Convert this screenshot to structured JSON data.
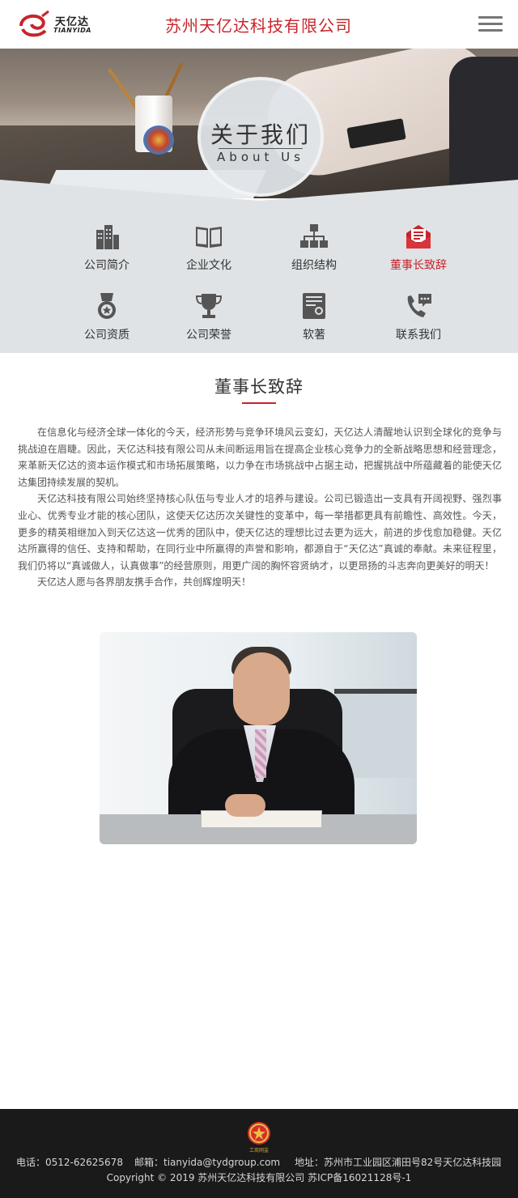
{
  "header": {
    "logo_cn": "天亿达",
    "logo_en": "TIANYIDA",
    "company_name": "苏州天亿达科技有限公司"
  },
  "banner": {
    "title_cn": "关于我们",
    "title_en": "About Us"
  },
  "nav": {
    "items": [
      {
        "label": "公司简介",
        "icon": "building-icon"
      },
      {
        "label": "企业文化",
        "icon": "book-icon"
      },
      {
        "label": "组织结构",
        "icon": "org-chart-icon"
      },
      {
        "label": "董事长致辞",
        "icon": "letter-icon",
        "active": true
      },
      {
        "label": "公司资质",
        "icon": "medal-icon"
      },
      {
        "label": "公司荣誉",
        "icon": "trophy-icon"
      },
      {
        "label": "软著",
        "icon": "certificate-icon"
      },
      {
        "label": "联系我们",
        "icon": "phone-chat-icon"
      }
    ]
  },
  "article": {
    "title": "董事长致辞",
    "paragraphs": [
      "在信息化与经济全球一体化的今天，经济形势与竞争环境风云变幻，天亿达人清醒地认识到全球化的竞争与挑战迫在眉睫。因此，天亿达科技有限公司从未间断运用旨在提高企业核心竞争力的全新战略思想和经营理念，来革新天亿达的资本运作模式和市场拓展策略，以力争在市场挑战中占据主动，把握挑战中所蕴藏着的能使天亿达集团持续发展的契机。",
      "天亿达科技有限公司始终坚持核心队伍与专业人才的培养与建设。公司已锻造出一支具有开阔视野、强烈事业心、优秀专业才能的核心团队，这使天亿达历次关键性的变革中，每一举措都更具有前瞻性、高效性。今天，更多的精英相继加入到天亿达这一优秀的团队中，使天亿达的理想比过去更为远大，前进的步伐愈加稳健。天亿达所赢得的信任、支持和帮助，在同行业中所赢得的声誉和影响，都源自于“天亿达”真诚的奉献。未来征程里，我们仍将以“真诚做人，认真做事”的经营原则，用更广阔的胸怀容贤纳才，以更昂扬的斗志奔向更美好的明天！",
      "天亿达人愿与各界朋友携手合作，共创辉煌明天！"
    ]
  },
  "footer": {
    "emblem_text": "工商网监",
    "phone": "电话：0512-62625678",
    "email": "邮箱：tianyida@tydgroup.com",
    "address": "地址：苏州市工业园区浦田号82号天亿达科技园",
    "copyright": "Copyright © 2019 苏州天亿达科技有限公司 苏ICP备16021128号-1"
  },
  "colors": {
    "accent": "#c8242b",
    "nav_bg": "#dfe3e6",
    "icon_gray": "#555555",
    "footer_bg": "#1a1a1a"
  }
}
